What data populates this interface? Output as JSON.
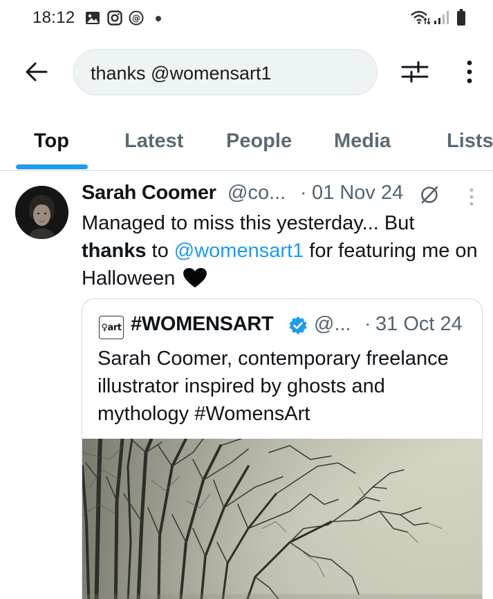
{
  "status_bar": {
    "time": "18:12",
    "icons": [
      "gallery-icon",
      "instagram-icon",
      "threads-icon",
      "notification-dot",
      "wifi-icon",
      "signal-icon",
      "battery-icon"
    ]
  },
  "search": {
    "query": "thanks @womensart1",
    "back_icon": "arrow-left-icon",
    "filter_icon": "sliders-icon",
    "more_icon": "vertical-dots-icon"
  },
  "tabs": [
    {
      "label": "Top",
      "active": true
    },
    {
      "label": "Latest",
      "active": false
    },
    {
      "label": "People",
      "active": false
    },
    {
      "label": "Media",
      "active": false
    },
    {
      "label": "Lists",
      "active": false
    }
  ],
  "tweet": {
    "author_name": "Sarah Coomer",
    "author_handle": "@co...",
    "separator": "·",
    "date": "01 Nov 24",
    "body": {
      "part1": "Managed to miss this yesterday... But ",
      "bold": "thanks",
      "part2": " to ",
      "mention": "@womensart1",
      "part3": " for featuring me on Halloween"
    },
    "quote": {
      "avatar_text": "♀art",
      "name": "#WOMENSART",
      "handle": "@...",
      "separator": "·",
      "date": "31 Oct 24",
      "body": "Sarah Coomer, contemporary freelance illustrator inspired by ghosts and mythology #WomensArt"
    }
  },
  "colors": {
    "accent": "#1d9bf0",
    "text_primary": "#0f1419",
    "text_secondary": "#536471",
    "search_bg": "#eef3f4"
  }
}
